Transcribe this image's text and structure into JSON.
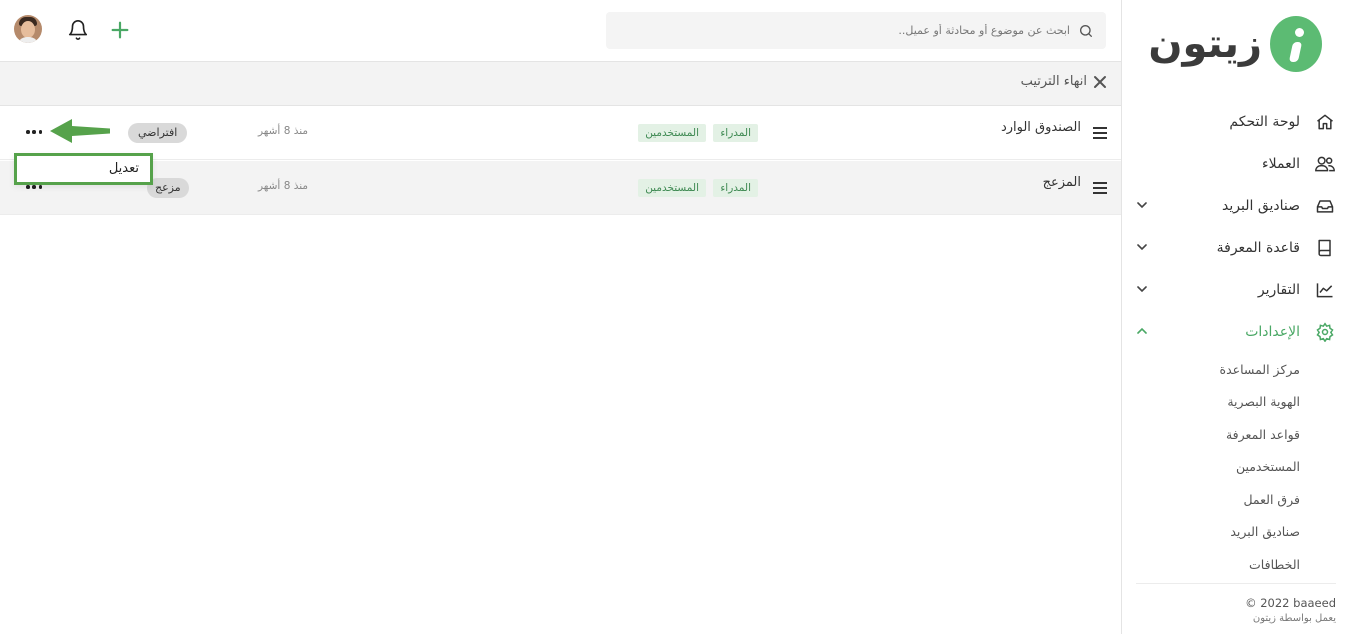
{
  "brand": {
    "name": "زيتون",
    "accent": "#5cbb73"
  },
  "search": {
    "placeholder": "ابحث عن موضوع أو محادثة أو عميل.."
  },
  "sidebar": {
    "items": [
      {
        "label": "لوحة التحكم",
        "icon": "home-icon"
      },
      {
        "label": "العملاء",
        "icon": "users-icon"
      },
      {
        "label": "صناديق البريد",
        "icon": "inbox-icon"
      },
      {
        "label": "قاعدة المعرفة",
        "icon": "book-icon"
      },
      {
        "label": "التقارير",
        "icon": "chart-icon"
      },
      {
        "label": "الإعدادات",
        "icon": "gear-icon"
      }
    ],
    "settings_sub": [
      "مركز المساعدة",
      "الهوية البصرية",
      "قواعد المعرفة",
      "المستخدمين",
      "فرق العمل",
      "صناديق البريد",
      "الخطافات"
    ],
    "footer": {
      "copyright": "© 2022 baaeed",
      "powered": "يعمل بواسطة زيتون"
    }
  },
  "toolbar": {
    "end_sort": "انهاء الترتيب"
  },
  "rows": [
    {
      "name": "الصندوق الوارد",
      "tags": [
        "المدراء",
        "المستخدمين"
      ],
      "time": "منذ 8 أشهر",
      "badge": "افتراضي"
    },
    {
      "name": "المزعج",
      "tags": [
        "المدراء",
        "المستخدمين"
      ],
      "time": "منذ 8 أشهر",
      "badge": "مزعج"
    }
  ],
  "context_menu": {
    "edit": "تعديل"
  }
}
